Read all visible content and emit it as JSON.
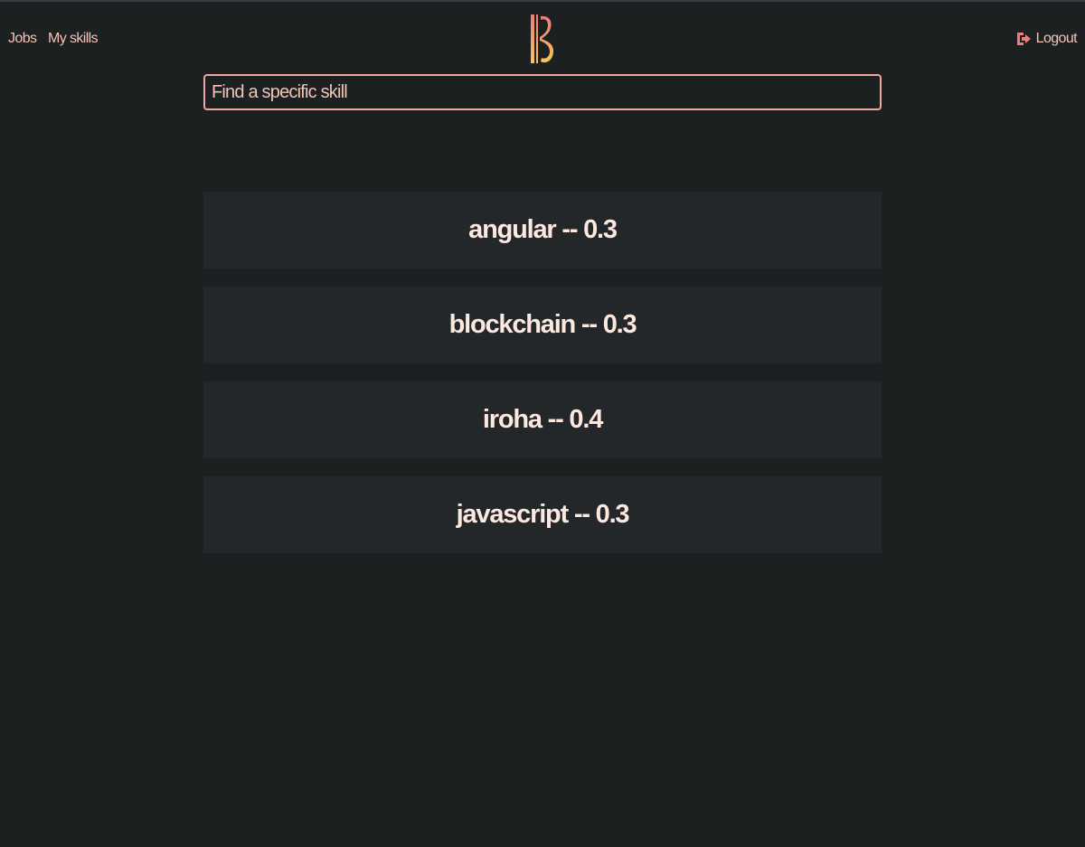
{
  "nav": {
    "jobs_label": "Jobs",
    "my_skills_label": "My skills",
    "logout_label": "Logout"
  },
  "logo": {
    "icon": "violin-logo-icon",
    "gradient_top": "#f07c7c",
    "gradient_bottom": "#f5c55a"
  },
  "search": {
    "placeholder": "Find a specific skill",
    "value": ""
  },
  "skills": [
    {
      "name": "angular",
      "score": "0.3",
      "label": "angular -- 0.3"
    },
    {
      "name": "blockchain",
      "score": "0.3",
      "label": "blockchain -- 0.3"
    },
    {
      "name": "iroha",
      "score": "0.4",
      "label": "iroha -- 0.4"
    },
    {
      "name": "javascript",
      "score": "0.3",
      "label": "javascript -- 0.3"
    }
  ],
  "colors": {
    "background": "#1d2021",
    "card": "#232729",
    "accent": "#f0a7a0",
    "nav_text": "#f2c4b8",
    "card_text": "#fde8e0"
  }
}
